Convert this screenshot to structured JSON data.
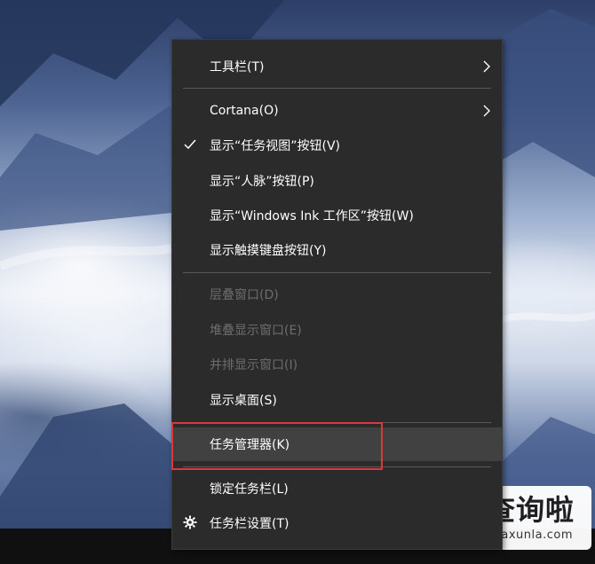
{
  "menu": {
    "items": [
      {
        "label": "工具栏(T)"
      },
      {
        "label": "Cortana(O)"
      },
      {
        "label": "显示“任务视图”按钮(V)"
      },
      {
        "label": "显示“人脉”按钮(P)"
      },
      {
        "label": "显示“Windows Ink 工作区”按钮(W)"
      },
      {
        "label": "显示触摸键盘按钮(Y)"
      },
      {
        "label": "层叠窗口(D)"
      },
      {
        "label": "堆叠显示窗口(E)"
      },
      {
        "label": "并排显示窗口(I)"
      },
      {
        "label": "显示桌面(S)"
      },
      {
        "label": "任务管理器(K)"
      },
      {
        "label": "锁定任务栏(L)"
      },
      {
        "label": "任务栏设置(T)"
      }
    ],
    "checked_item": "显示“任务视图”按钮(V)",
    "disabled_items": [
      "层叠窗口(D)",
      "堆叠显示窗口(E)",
      "并排显示窗口(I)"
    ],
    "highlighted_item": "任务管理器(K)",
    "submenu_items": [
      "工具栏(T)",
      "Cortana(O)"
    ],
    "icons": {
      "check": "checkmark-icon",
      "settings": "gear-icon",
      "submenu": "chevron-right-icon"
    },
    "colors": {
      "background": "#2b2b2b",
      "text": "#ffffff",
      "disabled_text": "#6d6d6d",
      "highlight": "#414141",
      "annotation_border": "#d63a3a"
    }
  },
  "watermark": {
    "text_cn": "查询啦",
    "text_en": "chaxunla.com"
  }
}
